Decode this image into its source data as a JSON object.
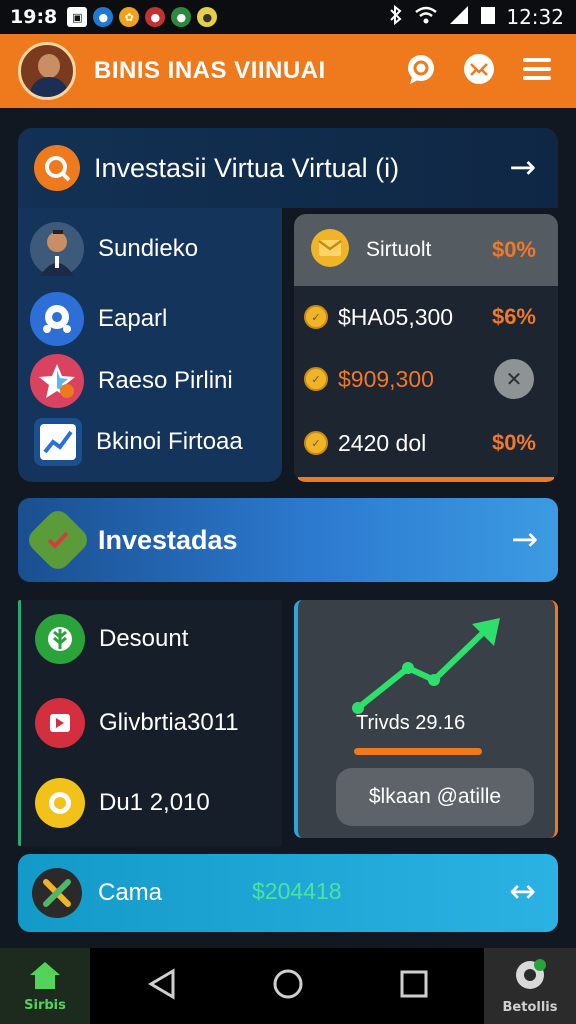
{
  "status_bar": {
    "time_left": "19:8",
    "clock": "12:32"
  },
  "app_bar": {
    "title": "BINIS INAS VIINUAI",
    "accent": "#ef7a1e"
  },
  "header": {
    "title": "Investasii Virtua Virtual (i)",
    "arrow": "→"
  },
  "list": {
    "items": [
      {
        "label": "Sundieko",
        "icon": "person-avatar-icon"
      },
      {
        "label": "Eaparl",
        "icon": "chat-bubble-icon"
      },
      {
        "label": "Raeso Pirlini",
        "icon": "star-icon"
      },
      {
        "label": "Bkinoi Firtoaa",
        "icon": "chart-icon"
      }
    ]
  },
  "stats": {
    "header_label": "Sirtuolt",
    "header_pct": "$0%",
    "rows": [
      {
        "value": "$HA05,300",
        "pct": "$6%"
      },
      {
        "value": "$909,300",
        "pct": ""
      },
      {
        "value": "2420 dol",
        "pct": "$0%"
      }
    ]
  },
  "investments": {
    "label": "Investadas",
    "arrow": "→"
  },
  "lower_list": {
    "items": [
      {
        "label": "Desount",
        "icon": "leaf-icon"
      },
      {
        "label": "Glivbrtia3011",
        "icon": "media-icon"
      },
      {
        "label": "Du1 2,010",
        "icon": "coin-icon"
      }
    ]
  },
  "trend": {
    "label": "Trivds 29.16",
    "button": "$lkaan @atille",
    "line_color": "#2ee06b"
  },
  "camera_row": {
    "label": "Cama",
    "amount": "$204418",
    "arrow": "↔"
  },
  "bottom_nav": {
    "home_label": "Sirbis",
    "settings_label": "Betollis"
  }
}
